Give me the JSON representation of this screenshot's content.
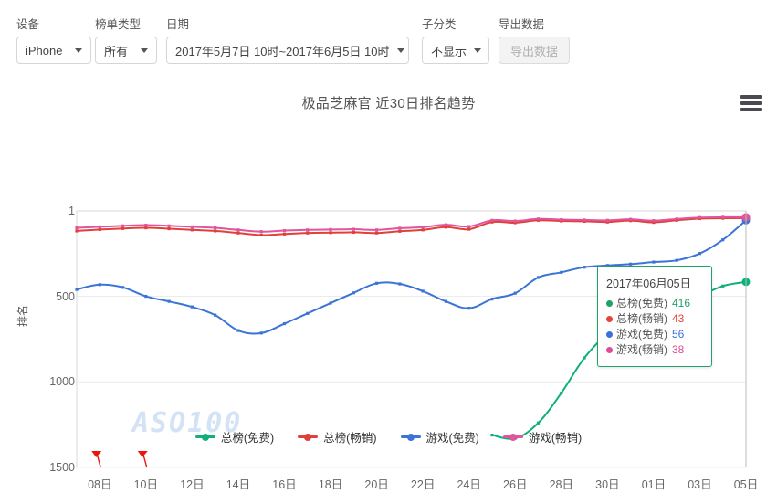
{
  "toolbar": {
    "fields": [
      {
        "label": "设备",
        "value": "iPhone",
        "type": "select"
      },
      {
        "label": "榜单类型",
        "value": "所有",
        "type": "select"
      },
      {
        "label": "日期",
        "value": "2017年5月7日 10时~2017年6月5日 10时",
        "type": "select"
      },
      {
        "label": "子分类",
        "value": "不显示",
        "type": "select"
      }
    ],
    "export": {
      "label": "导出数据",
      "button_label": "导出数据",
      "disabled": true
    }
  },
  "chart": {
    "title": "极品芝麻官 近30日排名趋势",
    "menu_icon": "hamburger-menu-icon",
    "watermark": "ASO100"
  },
  "tooltip": {
    "date": "2017年06月05日",
    "rows": [
      {
        "name": "总榜(免费)",
        "value": "416",
        "color": "#21a06a"
      },
      {
        "name": "总榜(畅销)",
        "value": "43",
        "color": "#e8443b"
      },
      {
        "name": "游戏(免费)",
        "value": "56",
        "color": "#3b6fe0"
      },
      {
        "name": "游戏(畅销)",
        "value": "38",
        "color": "#dd4c96"
      }
    ]
  },
  "legend": [
    {
      "label": "总榜(免费)",
      "color": "#0fb07a"
    },
    {
      "label": "总榜(畅销)",
      "color": "#e0403a"
    },
    {
      "label": "游戏(免费)",
      "color": "#3b74d6"
    },
    {
      "label": "游戏(畅销)",
      "color": "#e0559b"
    }
  ],
  "chart_data": {
    "type": "line",
    "title": "极品芝麻官 近30日排名趋势",
    "xlabel": "",
    "ylabel": "排名",
    "ylim": [
      1,
      1500
    ],
    "y_inverted": true,
    "y_ticks": [
      "1",
      "500",
      "1000",
      "1500"
    ],
    "y_tick_values": [
      1,
      500,
      1000,
      1500
    ],
    "grid": true,
    "legend_position": "bottom",
    "x": [
      "07日",
      "08日",
      "09日",
      "10日",
      "11日",
      "12日",
      "13日",
      "14日",
      "15日",
      "16日",
      "17日",
      "18日",
      "19日",
      "20日",
      "21日",
      "22日",
      "23日",
      "24日",
      "25日",
      "26日",
      "27日",
      "28日",
      "29日",
      "30日",
      "31日",
      "01日",
      "02日",
      "03日",
      "04日",
      "05日"
    ],
    "x_ticks": [
      "08日",
      "10日",
      "12日",
      "14日",
      "16日",
      "18日",
      "20日",
      "22日",
      "24日",
      "26日",
      "28日",
      "30日",
      "01日",
      "03日",
      "05日"
    ],
    "annotations": [
      {
        "type": "marker-flag",
        "color": "#e8170f",
        "x": "08日",
        "y": 1500
      },
      {
        "type": "marker-flag",
        "color": "#e8170f",
        "x": "10日",
        "y": 1500
      }
    ],
    "series": [
      {
        "name": "总榜(免费)",
        "color": "#0fb07a",
        "values": [
          null,
          null,
          null,
          null,
          null,
          null,
          null,
          null,
          null,
          null,
          null,
          null,
          null,
          null,
          null,
          null,
          null,
          null,
          1311,
          1330,
          1240,
          1065,
          860,
          720,
          640,
          600,
          560,
          500,
          440,
          416
        ]
      },
      {
        "name": "总榜(畅销)",
        "color": "#e0403a",
        "values": [
          118,
          110,
          104,
          100,
          105,
          112,
          118,
          130,
          142,
          136,
          130,
          128,
          126,
          130,
          120,
          112,
          96,
          108,
          66,
          70,
          56,
          60,
          62,
          66,
          58,
          68,
          56,
          46,
          44,
          43
        ]
      },
      {
        "name": "游戏(免费)",
        "color": "#3b74d6",
        "values": [
          460,
          432,
          448,
          500,
          530,
          562,
          610,
          700,
          715,
          660,
          600,
          540,
          480,
          424,
          428,
          470,
          530,
          570,
          516,
          482,
          390,
          360,
          330,
          320,
          312,
          300,
          290,
          250,
          170,
          56
        ]
      },
      {
        "name": "游戏(畅销)",
        "color": "#e0559b",
        "values": [
          100,
          94,
          88,
          84,
          88,
          94,
          100,
          112,
          122,
          116,
          112,
          110,
          108,
          112,
          102,
          96,
          82,
          92,
          56,
          60,
          48,
          52,
          54,
          56,
          50,
          58,
          48,
          40,
          38,
          38
        ]
      }
    ]
  }
}
